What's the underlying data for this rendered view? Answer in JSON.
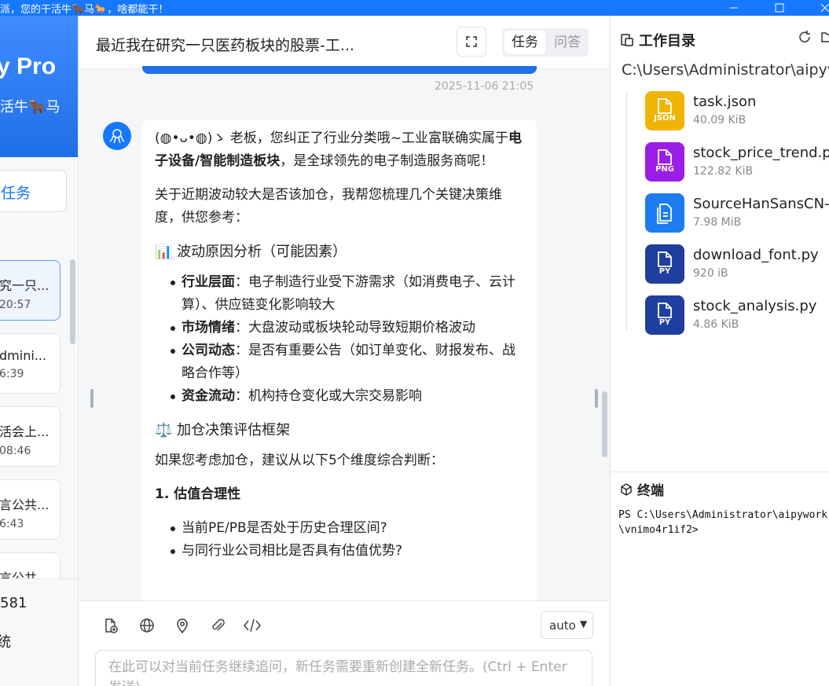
{
  "window": {
    "title": "派，您的干活牛🐂马🐎，啥都能干！"
  },
  "sidebar": {
    "brand_name": "y Pro",
    "brand_tagline": "活牛🐂马",
    "new_task": "任务",
    "history": [
      {
        "title": "究一只...",
        "time": "20:57"
      },
      {
        "title": "dmini...",
        "time": "6:39"
      },
      {
        "title": "活会上...",
        "time": "08:46"
      },
      {
        "title": "言公共...",
        "time": "6:43"
      },
      {
        "title": "言公共",
        "time": ""
      }
    ],
    "bottom_a": "581",
    "bottom_b": "统"
  },
  "chat": {
    "title": "最近我在研究一只医药板块的股票-工...",
    "mode_task": "任务",
    "mode_qa": "问答",
    "timestamp": "2025-11-06 21:05",
    "message": {
      "p1_a": "(◍•ᴗ•◍)ゝ 老板，您纠正了行业分类哦~工业富联确实属于",
      "p1_b": "电子设备/智能制造板块",
      "p1_c": "，是全球领先的电子制造服务商呢！",
      "p2": "关于近期波动较大是否该加仓，我帮您梳理几个关键决策维度，供您参考：",
      "h1": "📊 波动原因分析（可能因素）",
      "bullets1": [
        {
          "k": "行业层面",
          "v": "：电子制造行业受下游需求（如消费电子、云计算）、供应链变化影响较大"
        },
        {
          "k": "市场情绪",
          "v": "：大盘波动或板块轮动导致短期价格波动"
        },
        {
          "k": "公司动态",
          "v": "：是否有重要公告（如订单变化、财报发布、战略合作等）"
        },
        {
          "k": "资金流动",
          "v": "：机构持仓变化或大宗交易影响"
        }
      ],
      "h2": "⚖️ 加仓决策评估框架",
      "p3": "如果您考虑加仓，建议从以下5个维度综合判断：",
      "h3": "1. 估值合理性",
      "bullets2": [
        "当前PE/PB是否处于历史合理区间?",
        "与同行业公司相比是否具有估值优势?"
      ]
    },
    "composer": {
      "model": "auto",
      "placeholder": "在此可以对当前任务继续追问，新任务需要重新创建全新任务。(Ctrl + Enter 发送)"
    }
  },
  "workspace": {
    "title": "工作目录",
    "path": "C:\\Users\\Administrator\\aipyw",
    "files": [
      {
        "name": "task.json",
        "size": "40.09 KiB",
        "badge": "JSON",
        "color": "#f0b400"
      },
      {
        "name": "stock_price_trend.png",
        "size": "122.82 KiB",
        "badge": "PNG",
        "color": "#9b1ee8"
      },
      {
        "name": "SourceHanSansCN-...",
        "size": "7.98 MiB",
        "badge": "",
        "color": "#1e7cf2"
      },
      {
        "name": "download_font.py",
        "size": "920 iB",
        "badge": "PY",
        "color": "#1f3f9f"
      },
      {
        "name": "stock_analysis.py",
        "size": "4.86 KiB",
        "badge": "PY",
        "color": "#1f3f9f"
      }
    ],
    "terminal_title": "终端",
    "terminal_output": "PS C:\\Users\\Administrator\\aipywork\\vnimo4r1if2>"
  }
}
